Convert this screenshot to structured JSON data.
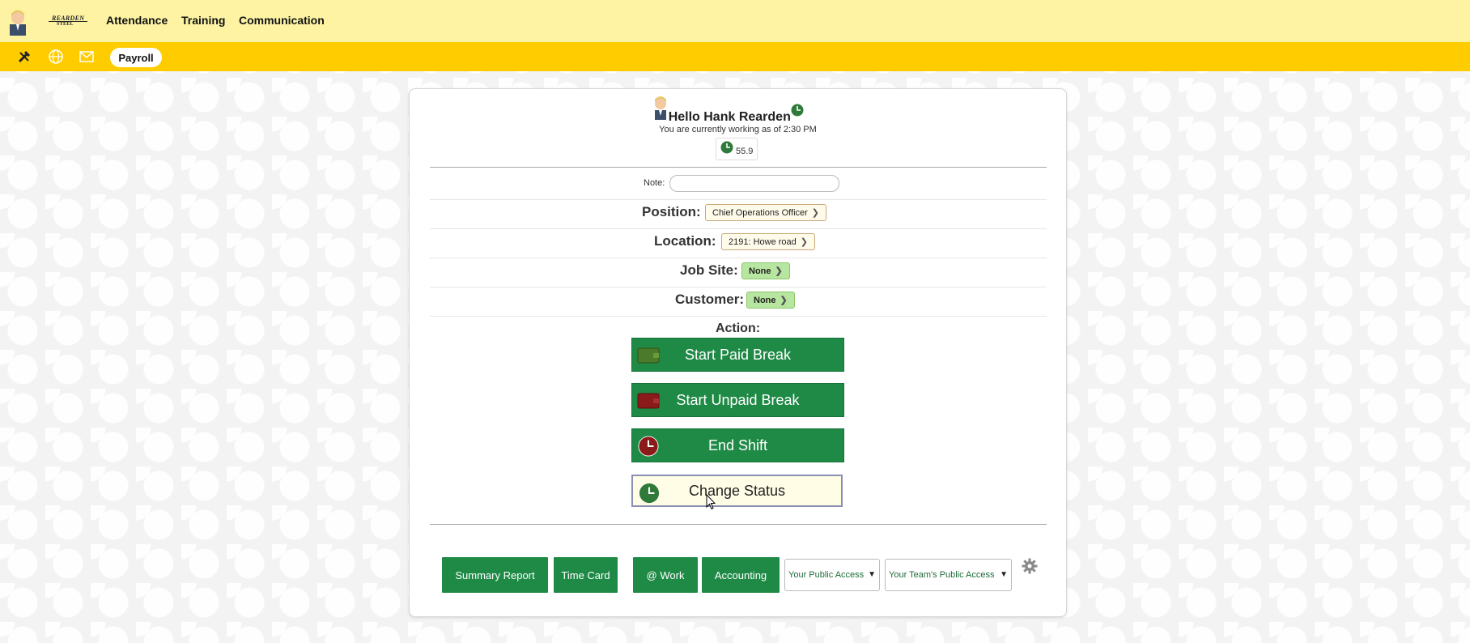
{
  "topbar": {
    "logo_line1": "REARDEN",
    "logo_line2": "STEEL",
    "nav": [
      "Attendance",
      "Training",
      "Communication"
    ]
  },
  "subbar": {
    "icons": [
      "tools-icon",
      "globe-icon",
      "mail-icon"
    ],
    "payroll_label": "Payroll"
  },
  "card": {
    "greeting": "Hello Hank Rearden",
    "status_line": "You are currently working as of 2:30 PM",
    "hours": "55.9",
    "note_label": "Note:",
    "note_value": "",
    "position_label": "Position:",
    "position_value": "Chief Operations Officer",
    "location_label": "Location:",
    "location_value": "2191: Howe road",
    "jobsite_label": "Job Site:",
    "jobsite_value": "None",
    "customer_label": "Customer:",
    "customer_value": "None",
    "action_label": "Action:",
    "actions": {
      "paid_break": "Start Paid Break",
      "unpaid_break": "Start Unpaid Break",
      "end_shift": "End Shift",
      "change_status": "Change Status"
    },
    "bottom": {
      "summary_report": "Summary Report",
      "time_card": "Time Card",
      "at_work": "@ Work",
      "accounting": "Accounting",
      "public_access": "Your Public Access",
      "team_public_access": "Your Team's Public Access"
    }
  },
  "colors": {
    "topbar_bg": "#fdf3a3",
    "subbar_bg": "#ffcc00",
    "action_green": "#1f8a46",
    "paid_break_icon": "#4a7a2a",
    "unpaid_break_icon": "#8b1a1a",
    "end_shift_icon": "#8b1a1a",
    "change_status_icon": "#2f7a3a"
  }
}
